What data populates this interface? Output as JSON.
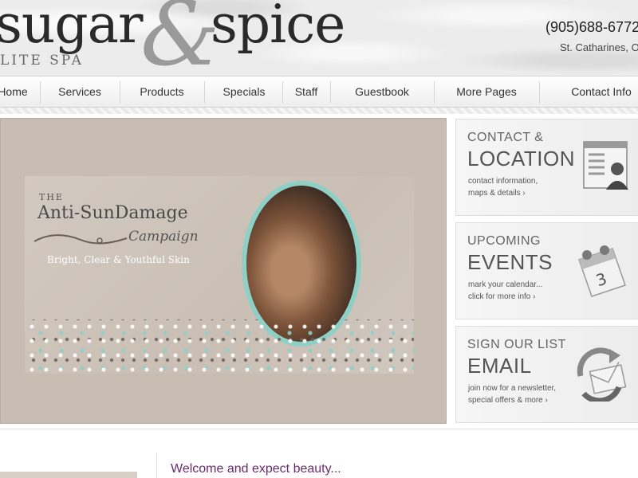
{
  "header": {
    "logo_main": "sugar",
    "logo_amp": "&",
    "logo_second": "spice",
    "logo_tag": "LITE SPA",
    "phone": "(905)688-6772",
    "city": "St. Catharines, ON"
  },
  "nav": {
    "items": [
      "Home",
      "Services",
      "Products",
      "Specials",
      "Staff",
      "Guestbook",
      "More Pages",
      "Contact Info"
    ]
  },
  "hero": {
    "pre_title": "THE",
    "title": "Anti-SunDamage",
    "campaign": "Campaign",
    "tagline": "Bright, Clear & Youthful Skin"
  },
  "cards": [
    {
      "small": "CONTACT &",
      "big": "LOCATION",
      "line1": "contact information,",
      "line2": "maps & details  ›",
      "icon": "contact-card-icon"
    },
    {
      "small": "UPCOMING",
      "big": "EVENTS",
      "line1": "mark your calendar...",
      "line2": "click for more info  ›",
      "icon": "calendar-icon"
    },
    {
      "small": "SIGN OUR LIST",
      "big": "EMAIL",
      "line1": "join now for a newsletter,",
      "line2": "special offers & more  ›",
      "icon": "email-icon"
    }
  ],
  "main": {
    "welcome": "Welcome and expect beauty..."
  },
  "colors": {
    "accent_teal": "#8fd0c6",
    "welcome_purple": "#6b2a6b"
  }
}
